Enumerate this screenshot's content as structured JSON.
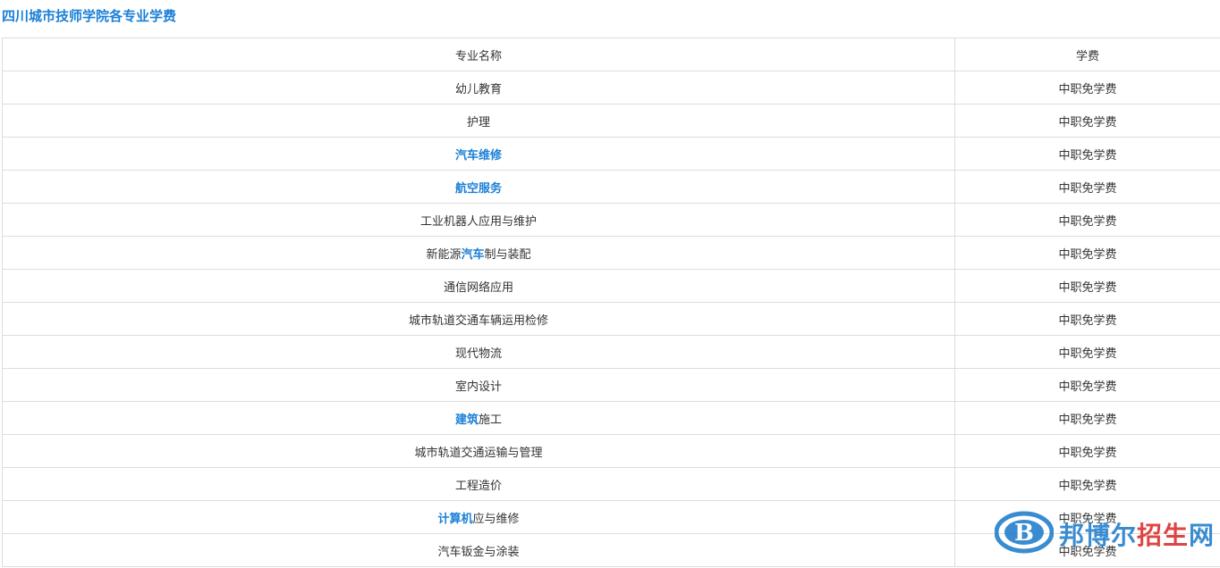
{
  "title": "四川城市技师学院各专业学费",
  "table": {
    "headers": [
      "专业名称",
      "学费"
    ],
    "rows": [
      {
        "parts": [
          {
            "text": "幼儿教育",
            "link": false
          }
        ],
        "fee": "中职免学费"
      },
      {
        "parts": [
          {
            "text": "护理",
            "link": false
          }
        ],
        "fee": "中职免学费"
      },
      {
        "parts": [
          {
            "text": "汽车维修",
            "link": true
          }
        ],
        "fee": "中职免学费"
      },
      {
        "parts": [
          {
            "text": "航空服务",
            "link": true
          }
        ],
        "fee": "中职免学费"
      },
      {
        "parts": [
          {
            "text": "工业机器人应用与维护",
            "link": false
          }
        ],
        "fee": "中职免学费"
      },
      {
        "parts": [
          {
            "text": "新能源",
            "link": false
          },
          {
            "text": "汽车",
            "link": true
          },
          {
            "text": "制与装配",
            "link": false
          }
        ],
        "fee": "中职免学费"
      },
      {
        "parts": [
          {
            "text": "通信网络应用",
            "link": false
          }
        ],
        "fee": "中职免学费"
      },
      {
        "parts": [
          {
            "text": "城市轨道交通车辆运用检修",
            "link": false
          }
        ],
        "fee": "中职免学费"
      },
      {
        "parts": [
          {
            "text": "现代物流",
            "link": false
          }
        ],
        "fee": "中职免学费"
      },
      {
        "parts": [
          {
            "text": "室内设计",
            "link": false
          }
        ],
        "fee": "中职免学费"
      },
      {
        "parts": [
          {
            "text": "建筑",
            "link": true
          },
          {
            "text": "施工",
            "link": false
          }
        ],
        "fee": "中职免学费"
      },
      {
        "parts": [
          {
            "text": "城市轨道交通运输与管理",
            "link": false
          }
        ],
        "fee": "中职免学费"
      },
      {
        "parts": [
          {
            "text": "工程造价",
            "link": false
          }
        ],
        "fee": "中职免学费"
      },
      {
        "parts": [
          {
            "text": "计算机",
            "link": true
          },
          {
            "text": "应与维修",
            "link": false
          }
        ],
        "fee": "中职免学费"
      },
      {
        "parts": [
          {
            "text": "汽车钣金与涂装",
            "link": false
          }
        ],
        "fee": "中职免学费"
      }
    ]
  },
  "watermark": {
    "text_blue": "邦博尔",
    "text_red": "招生",
    "text_blue2": "网",
    "icon": "b-logo-icon",
    "colors": {
      "blue": "#1878c8",
      "red": "#d92424"
    }
  }
}
